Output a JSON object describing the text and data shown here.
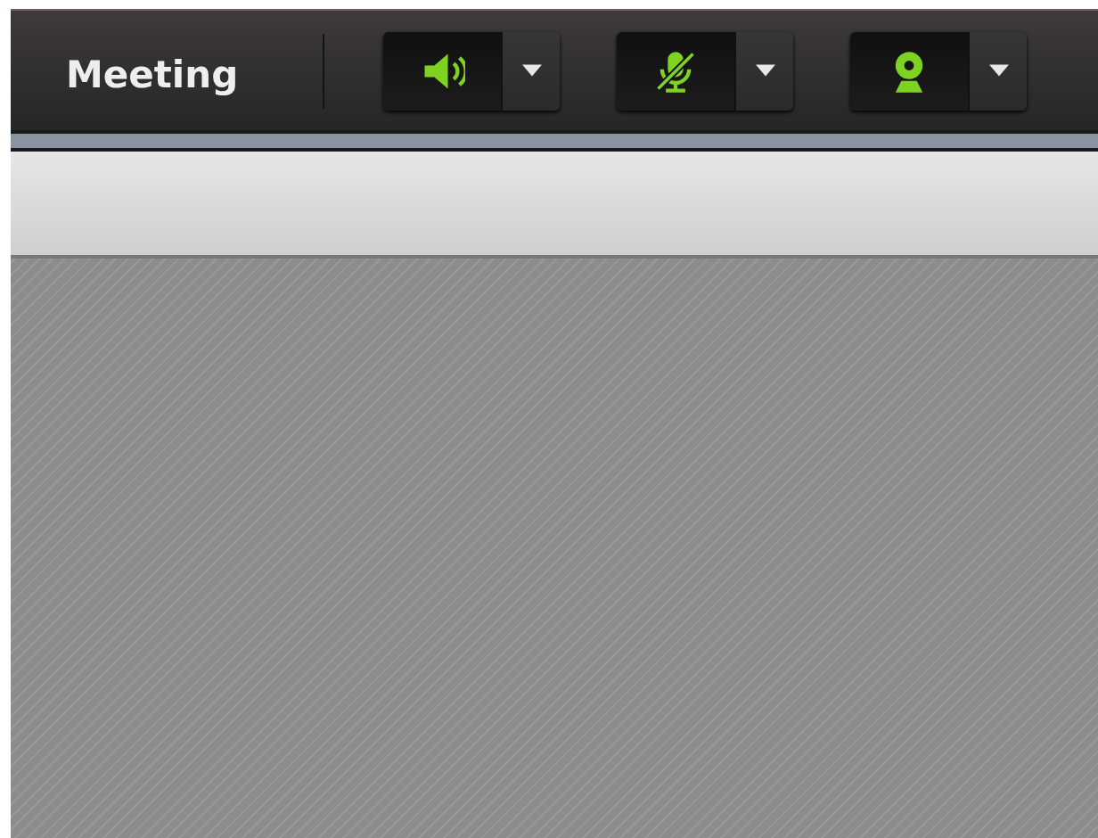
{
  "toolbar": {
    "title": "Meeting",
    "devices": [
      {
        "kind": "speaker",
        "muted": false
      },
      {
        "kind": "microphone",
        "muted": true
      },
      {
        "kind": "camera",
        "muted": false
      }
    ]
  }
}
